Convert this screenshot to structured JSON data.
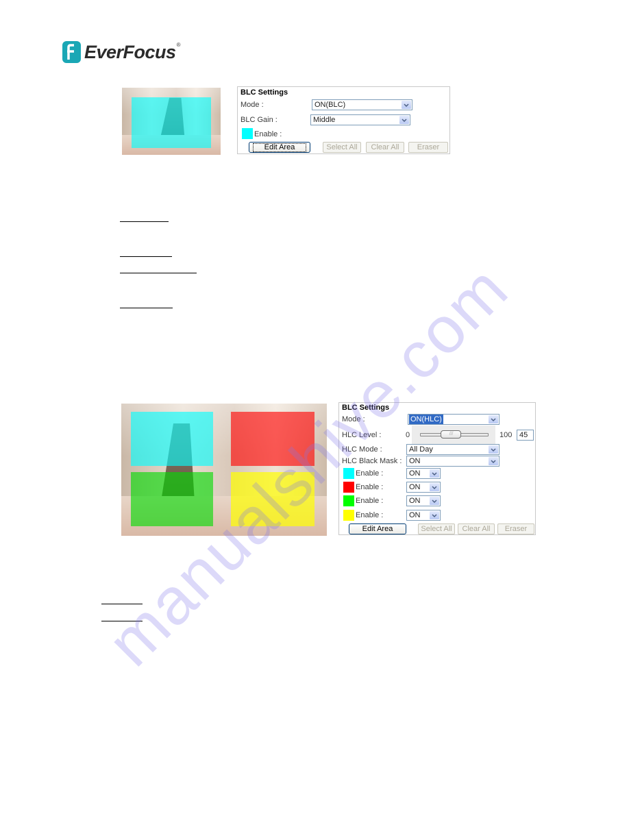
{
  "header": {
    "brand": "EverFocus",
    "registered_mark": "®",
    "logo_icon": "everfocus-f-logo-icon",
    "brand_color": "#1aa7b5"
  },
  "blc_panel": {
    "title": "BLC Settings",
    "mode_label": "Mode :",
    "mode_value": "ON(BLC)",
    "gain_label": "BLC Gain :",
    "gain_value": "Middle",
    "zones": [
      {
        "color": "#00ffff",
        "label": "Enable :"
      }
    ],
    "buttons": {
      "edit_area": "Edit Area",
      "select_all": "Select All",
      "clear_all": "Clear All",
      "eraser": "Eraser"
    }
  },
  "hlc_panel": {
    "title": "BLC Settings",
    "mode_label": "Mode :",
    "mode_value": "ON(HLC)",
    "level_label": "HLC Level :",
    "level_min": "0",
    "level_max": "100",
    "level_value": "45",
    "level_fraction": 0.45,
    "hlc_mode_label": "HLC Mode :",
    "hlc_mode_value": "All Day",
    "black_mask_label": "HLC Black Mask :",
    "black_mask_value": "ON",
    "zones": [
      {
        "color": "#00ffff",
        "label": "Enable :",
        "value": "ON"
      },
      {
        "color": "#ff0000",
        "label": "Enable :",
        "value": "ON"
      },
      {
        "color": "#00ff00",
        "label": "Enable :",
        "value": "ON"
      },
      {
        "color": "#ffff00",
        "label": "Enable :",
        "value": "ON"
      }
    ],
    "buttons": {
      "edit_area": "Edit Area",
      "select_all": "Select All",
      "clear_all": "Clear All",
      "eraser": "Eraser"
    }
  },
  "watermark": "manualshive.com"
}
